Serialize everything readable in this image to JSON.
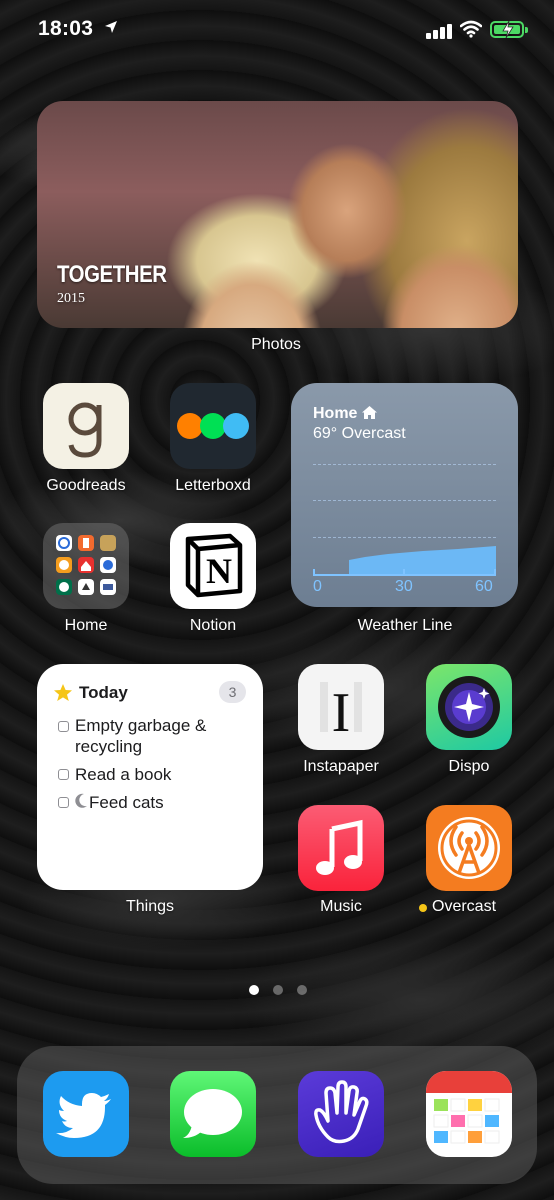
{
  "status_bar": {
    "time": "18:03"
  },
  "photos_widget": {
    "memory_title": "TOGETHER",
    "memory_year": "2015",
    "label": "Photos"
  },
  "apps": {
    "goodreads": {
      "label": "Goodreads"
    },
    "letterboxd": {
      "label": "Letterboxd"
    },
    "home_folder": {
      "label": "Home"
    },
    "notion": {
      "label": "Notion"
    },
    "instapaper": {
      "label": "Instapaper"
    },
    "dispo": {
      "label": "Dispo"
    },
    "music": {
      "label": "Music"
    },
    "overcast": {
      "label": "Overcast"
    }
  },
  "weather_widget": {
    "location": "Home",
    "condition": "69° Overcast",
    "axis_labels": [
      "0",
      "30",
      "60"
    ],
    "label": "Weather Line"
  },
  "things_widget": {
    "title": "Today",
    "count": "3",
    "items": [
      "Empty garbage & recycling",
      "Read a book",
      "Feed cats"
    ],
    "label": "Things"
  },
  "dock": {
    "apps": [
      "twitter",
      "messages",
      "hand-app",
      "calendar"
    ]
  },
  "colors": {
    "overcast": "#f47c20",
    "battery": "#4cd964",
    "things_star": "#f5c518"
  }
}
